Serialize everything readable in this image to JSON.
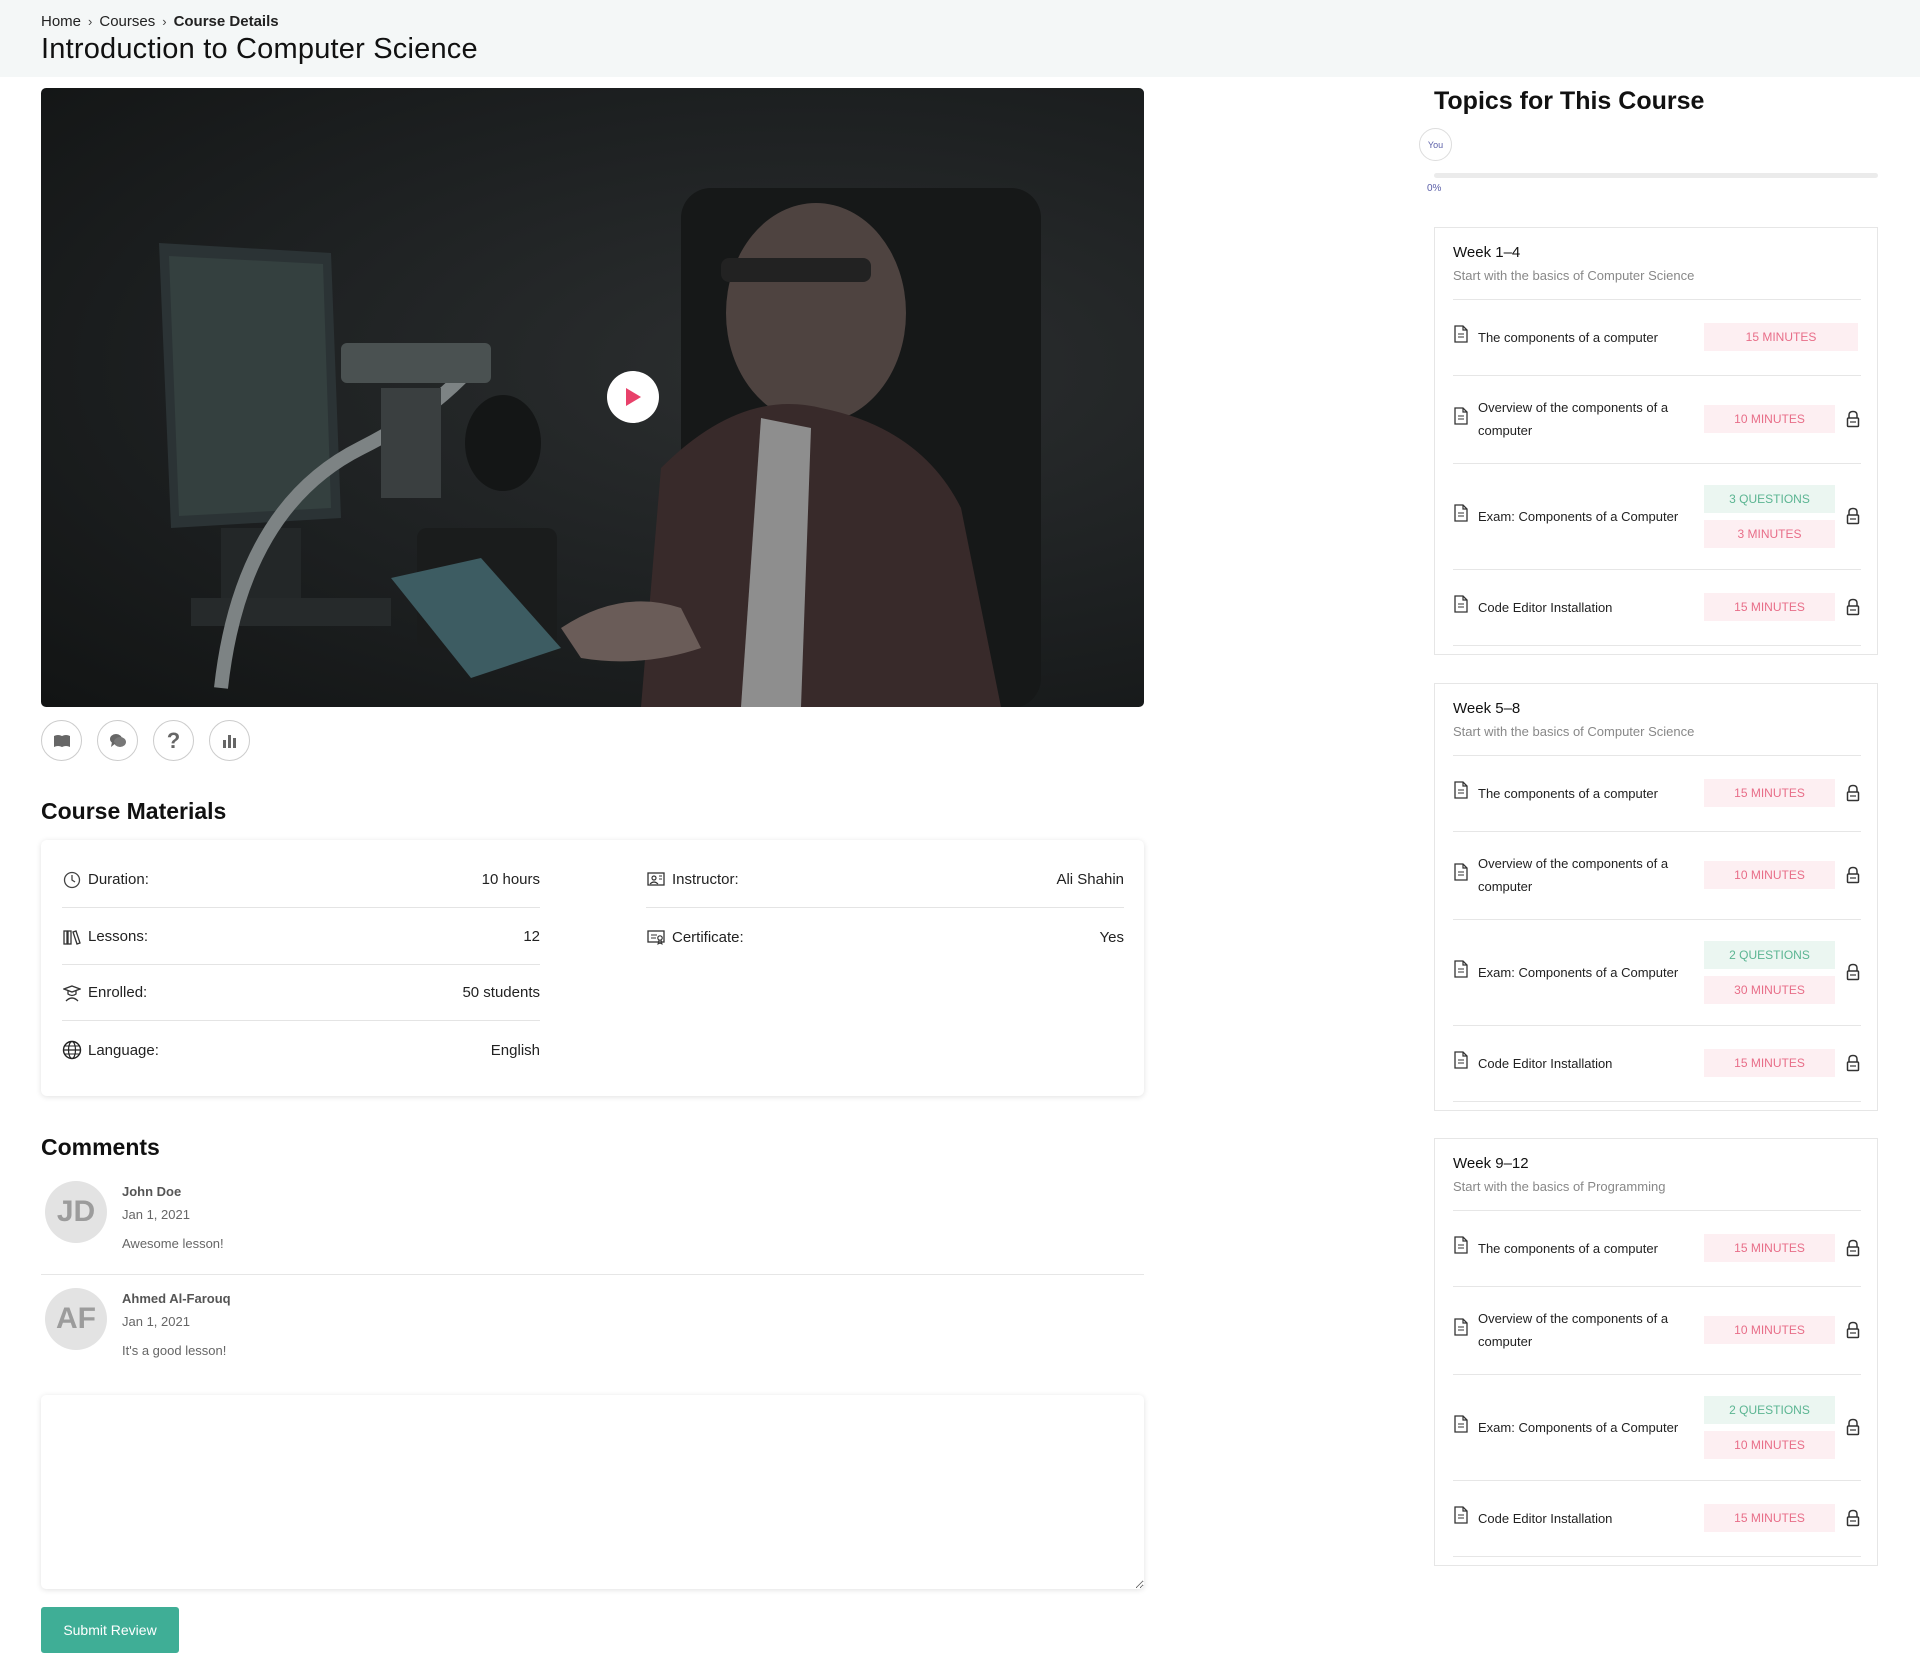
{
  "breadcrumb": {
    "home": "Home",
    "courses": "Courses",
    "current": "Course Details"
  },
  "page_title": "Introduction to Computer Science",
  "tools": [
    "book-icon",
    "chat-icon",
    "question-icon",
    "chart-icon"
  ],
  "materials": {
    "title": "Course Materials",
    "left": [
      {
        "icon": "clock-icon",
        "label": "Duration:",
        "value": "10 hours"
      },
      {
        "icon": "books-icon",
        "label": "Lessons:",
        "value": "12"
      },
      {
        "icon": "student-icon",
        "label": "Enrolled:",
        "value": "50 students"
      },
      {
        "icon": "globe-icon",
        "label": "Language:",
        "value": "English"
      }
    ],
    "right": [
      {
        "icon": "instructor-icon",
        "label": "Instructor:",
        "value": "Ali Shahin"
      },
      {
        "icon": "certificate-icon",
        "label": "Certificate:",
        "value": "Yes"
      }
    ]
  },
  "comments": {
    "title": "Comments",
    "items": [
      {
        "initials": "JD",
        "name": "John Doe",
        "date": "Jan 1, 2021",
        "text": "Awesome lesson!"
      },
      {
        "initials": "AF",
        "name": "Ahmed Al-Farouq",
        "date": "Jan 1, 2021",
        "text": "It's a good lesson!"
      }
    ],
    "submit_label": "Submit Review"
  },
  "topics": {
    "title": "Topics for This Course",
    "you_label": "You",
    "progress_label": "0%",
    "progress": 0,
    "weeks": [
      {
        "title": "Week 1–4",
        "subtitle": "Start with the basics of Computer Science",
        "lessons": [
          {
            "title": "The components of a computer",
            "tags": [
              "15 MINUTES"
            ],
            "locked": false
          },
          {
            "title": "Overview of the components of a computer",
            "tags": [
              "10 MINUTES"
            ],
            "locked": true
          },
          {
            "title": "Exam: Components of a Computer",
            "tags": [
              "3 QUESTIONS",
              "3 MINUTES"
            ],
            "locked": true
          },
          {
            "title": "Code Editor Installation",
            "tags": [
              "15 MINUTES"
            ],
            "locked": true
          }
        ]
      },
      {
        "title": "Week 5–8",
        "subtitle": "Start with the basics of Computer Science",
        "lessons": [
          {
            "title": "The components of a computer",
            "tags": [
              "15 MINUTES"
            ],
            "locked": true
          },
          {
            "title": "Overview of the components of a computer",
            "tags": [
              "10 MINUTES"
            ],
            "locked": true
          },
          {
            "title": "Exam: Components of a Computer",
            "tags": [
              "2 QUESTIONS",
              "30 MINUTES"
            ],
            "locked": true
          },
          {
            "title": "Code Editor Installation",
            "tags": [
              "15 MINUTES"
            ],
            "locked": true
          }
        ]
      },
      {
        "title": "Week 9–12",
        "subtitle": "Start with the basics of Programming",
        "lessons": [
          {
            "title": "The components of a computer",
            "tags": [
              "15 MINUTES"
            ],
            "locked": true
          },
          {
            "title": "Overview of the components of a computer",
            "tags": [
              "10 MINUTES"
            ],
            "locked": true
          },
          {
            "title": "Exam: Components of a Computer",
            "tags": [
              "2 QUESTIONS",
              "10 MINUTES"
            ],
            "locked": true
          },
          {
            "title": "Code Editor Installation",
            "tags": [
              "15 MINUTES"
            ],
            "locked": true
          }
        ]
      }
    ]
  },
  "colors": {
    "accent": "#3fae96",
    "play": "#e8416a",
    "minutes_tag": "#e86d88",
    "questions_tag": "#5bb592"
  }
}
